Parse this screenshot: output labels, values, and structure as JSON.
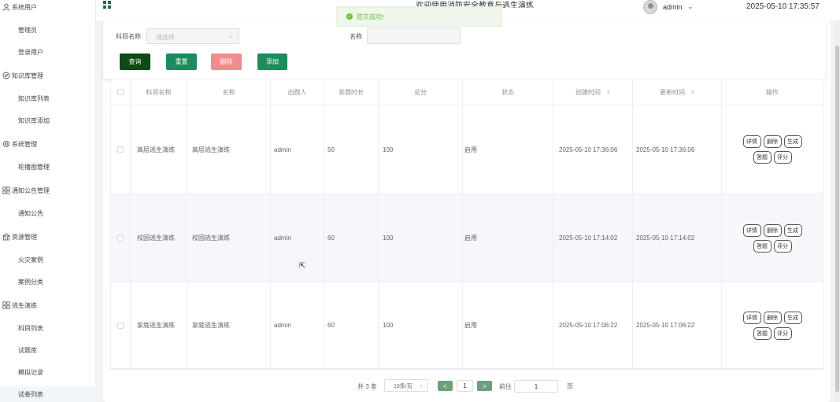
{
  "sidebar": {
    "items": [
      {
        "type": "group",
        "label": "系统用户",
        "icon": "user-icon"
      },
      {
        "type": "sub",
        "label": "管理员"
      },
      {
        "type": "sub",
        "label": "登录用户"
      },
      {
        "type": "group",
        "label": "知识库管理",
        "icon": "compass-icon"
      },
      {
        "type": "sub",
        "label": "知识库列表"
      },
      {
        "type": "sub",
        "label": "知识库添加"
      },
      {
        "type": "group",
        "label": "系统管理",
        "icon": "gear-icon"
      },
      {
        "type": "sub",
        "label": "轮播图管理"
      },
      {
        "type": "group",
        "label": "通知公告管理",
        "icon": "grid-icon"
      },
      {
        "type": "sub",
        "label": "通知公告"
      },
      {
        "type": "group",
        "label": "资源管理",
        "icon": "building-icon"
      },
      {
        "type": "sub",
        "label": "火灾案例"
      },
      {
        "type": "sub",
        "label": "案例分类"
      },
      {
        "type": "group",
        "label": "逃生演练",
        "icon": "grid-icon"
      },
      {
        "type": "sub",
        "label": "科目列表"
      },
      {
        "type": "sub",
        "label": "试题库"
      },
      {
        "type": "sub",
        "label": "模拟记录"
      },
      {
        "type": "sub",
        "label": "试卷列表",
        "active": true
      }
    ]
  },
  "header": {
    "title": "欢迎使用消防安全教育与逃生演练",
    "user": "admin",
    "datetime": "2025-05-10 17:35:57"
  },
  "toast": {
    "text": "提交成功!"
  },
  "search": {
    "subject_label": "科目名称",
    "subject_placeholder": "请选择",
    "name_label": "名称",
    "name_value": ""
  },
  "actions": {
    "query": "查询",
    "reset": "重置",
    "delete": "删除",
    "add": "添加"
  },
  "table": {
    "headers": [
      "科目名称",
      "名称",
      "出题人",
      "答题时长",
      "总分",
      "状态",
      "创建时间",
      "更新时间",
      "操作"
    ],
    "rows": [
      {
        "subject": "高层逃生演练",
        "name": "高层逃生演练",
        "author": "admin",
        "duration": "50",
        "score": "100",
        "status": "启用",
        "created": "2025-05-10 17:36:06",
        "updated": "2025-05-10 17:36:06"
      },
      {
        "subject": "校园逃生演练",
        "name": "校园逃生演练",
        "author": "admin",
        "duration": "60",
        "score": "100",
        "status": "启用",
        "created": "2025-05-10 17:14:02",
        "updated": "2025-05-10 17:14:02"
      },
      {
        "subject": "家庭逃生演练",
        "name": "家庭逃生演练",
        "author": "admin",
        "duration": "60",
        "score": "100",
        "status": "启用",
        "created": "2025-05-10 17:06:22",
        "updated": "2025-05-10 17:06:22"
      }
    ],
    "row_actions": [
      "详情",
      "删除",
      "生成",
      "答题",
      "评分"
    ]
  },
  "pagination": {
    "total": "共 3 条",
    "page_size": "10条/页",
    "prev": "<",
    "current": "1",
    "next": ">",
    "goto_label": "前往",
    "goto_value": "1",
    "page_suffix": "页"
  },
  "colors": {
    "primary": "#1c8c5c",
    "query": "#0e4a14",
    "danger": "#f08c8c",
    "pager_nav": "#6c9f7c"
  }
}
